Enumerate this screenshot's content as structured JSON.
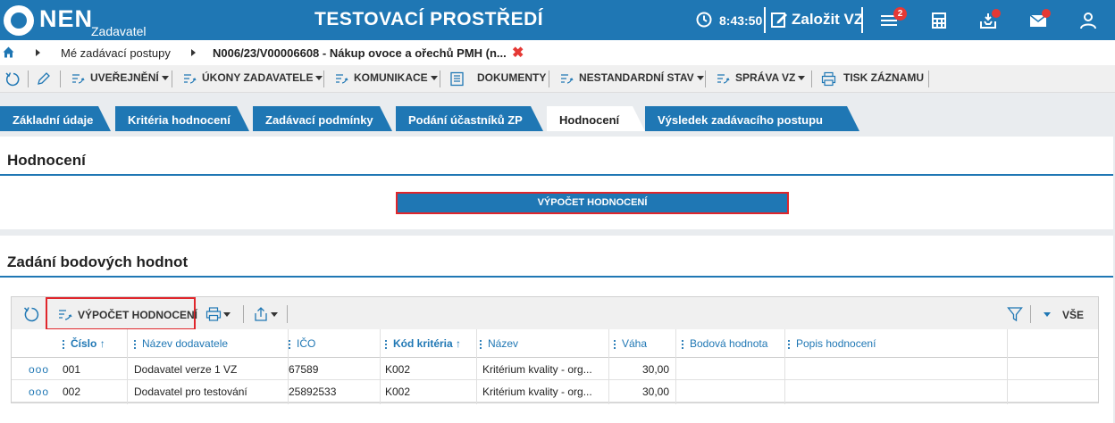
{
  "header": {
    "logo_text": "NEN",
    "logo_sub": "Zadavatel",
    "env_title": "TESTOVACÍ PROSTŘEDÍ",
    "time": "8:43:50",
    "create_label": "Založit VZ",
    "badge_count": "2",
    "accent": "#1f77b4"
  },
  "breadcrumb": {
    "items": [
      "Mé zadávací postupy",
      "N006/23/V00006608 - Nákup ovoce a ořechů PMH (n..."
    ],
    "close": "✖"
  },
  "toolbar": {
    "items": [
      {
        "label": "UVEŘEJNĚNÍ"
      },
      {
        "label": "ÚKONY ZADAVATELE"
      },
      {
        "label": "KOMUNIKACE"
      },
      {
        "label": "DOKUMENTY"
      },
      {
        "label": "NESTANDARDNÍ STAV"
      },
      {
        "label": "SPRÁVA VZ"
      },
      {
        "label": "TISK ZÁZNAMU"
      }
    ]
  },
  "tabs": [
    {
      "label": "Základní údaje"
    },
    {
      "label": "Kritéria hodnocení"
    },
    {
      "label": "Zadávací podmínky"
    },
    {
      "label": "Podání účastníků ZP"
    },
    {
      "label": "Hodnocení"
    },
    {
      "label": "Výsledek zadávacího postupu"
    }
  ],
  "hodnoceni": {
    "title": "Hodnocení",
    "button": "VÝPOČET HODNOCENÍ"
  },
  "body": {
    "title": "Zadání bodových hodnot",
    "grid_button": "VÝPOČET HODNOCENÍ",
    "filter_all": "VŠE",
    "columns": [
      "Číslo",
      "Název dodavatele",
      "IČO",
      "Kód kritéria",
      "Název",
      "Váha",
      "Bodová hodnota",
      "Popis hodnocení"
    ],
    "sort_arrow": "↑",
    "row_menu": "ooo",
    "rows": [
      {
        "cislo": "001",
        "dodavatel": "Dodavatel verze 1 VZ",
        "ico": "67589",
        "kod": "K002",
        "nazev": "Kritérium kvality - org...",
        "vaha": "30,00"
      },
      {
        "cislo": "002",
        "dodavatel": "Dodavatel pro testování",
        "ico": "25892533",
        "kod": "K002",
        "nazev": "Kritérium kvality - org...",
        "vaha": "30,00"
      }
    ]
  }
}
